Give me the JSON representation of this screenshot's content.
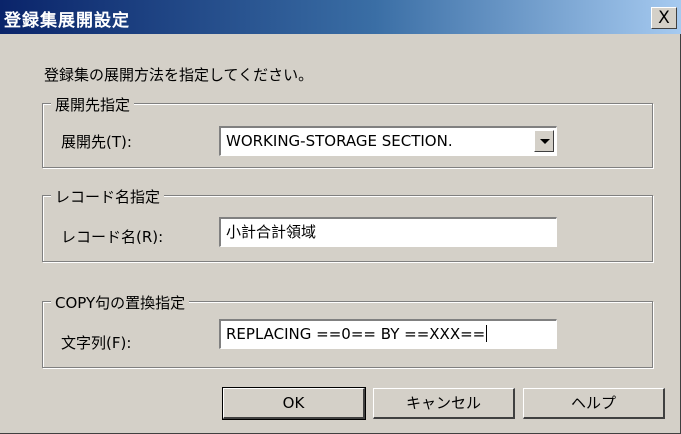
{
  "dialog": {
    "title": "登録集展開設定",
    "close_label": "X",
    "intro": "登録集の展開方法を指定してください。"
  },
  "group_dest": {
    "legend": "展開先指定",
    "label": "展開先(T):",
    "value": "WORKING-STORAGE SECTION."
  },
  "group_record": {
    "legend": "レコード名指定",
    "label": "レコード名(R):",
    "value": "小計合計領域"
  },
  "group_copy": {
    "legend": "COPY句の置換指定",
    "label": "文字列(F):",
    "value": "REPLACING ==0== BY ==XXX=="
  },
  "buttons": {
    "ok": "OK",
    "cancel": "キャンセル",
    "help": "ヘルプ"
  },
  "icons": {
    "close": "close-icon",
    "dropdown": "chevron-down-icon"
  },
  "colors": {
    "title_start": "#0a246a",
    "title_end": "#a6caf0",
    "face": "#d4d0c8"
  }
}
